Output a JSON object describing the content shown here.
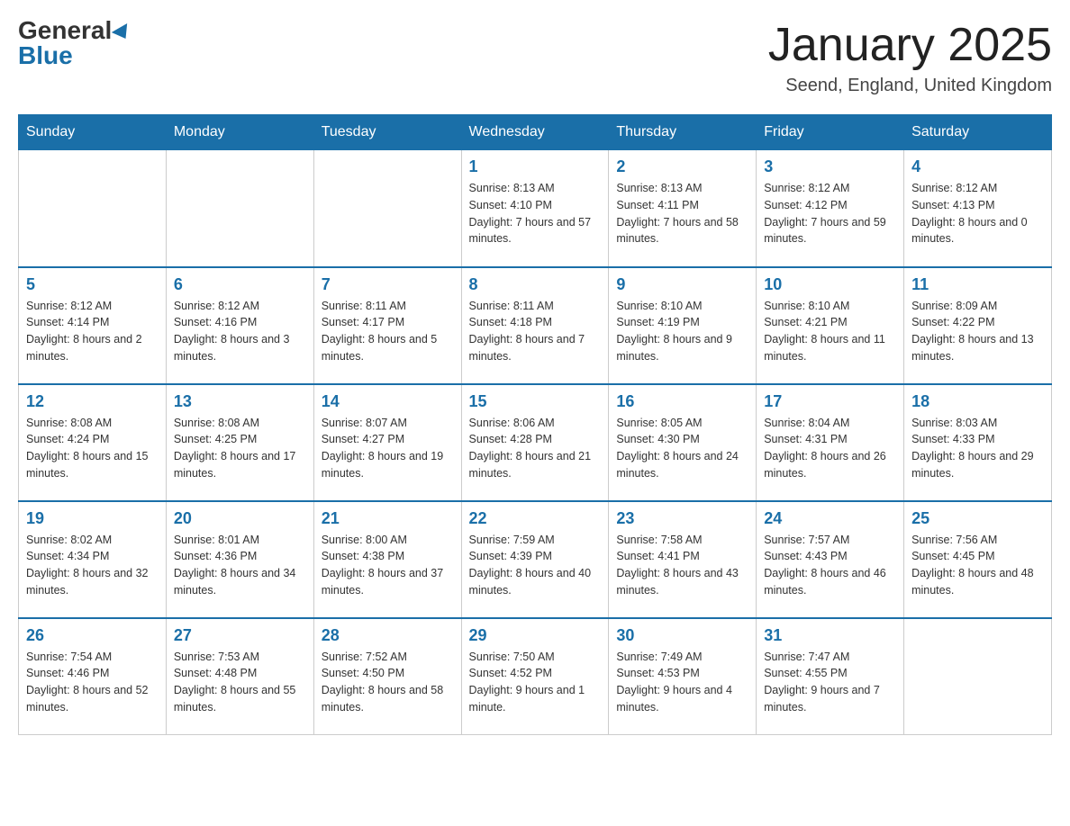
{
  "header": {
    "logo_general": "General",
    "logo_blue": "Blue",
    "title": "January 2025",
    "location": "Seend, England, United Kingdom"
  },
  "days_of_week": [
    "Sunday",
    "Monday",
    "Tuesday",
    "Wednesday",
    "Thursday",
    "Friday",
    "Saturday"
  ],
  "weeks": [
    [
      null,
      null,
      null,
      {
        "day": 1,
        "sunrise": "Sunrise: 8:13 AM",
        "sunset": "Sunset: 4:10 PM",
        "daylight": "Daylight: 7 hours and 57 minutes."
      },
      {
        "day": 2,
        "sunrise": "Sunrise: 8:13 AM",
        "sunset": "Sunset: 4:11 PM",
        "daylight": "Daylight: 7 hours and 58 minutes."
      },
      {
        "day": 3,
        "sunrise": "Sunrise: 8:12 AM",
        "sunset": "Sunset: 4:12 PM",
        "daylight": "Daylight: 7 hours and 59 minutes."
      },
      {
        "day": 4,
        "sunrise": "Sunrise: 8:12 AM",
        "sunset": "Sunset: 4:13 PM",
        "daylight": "Daylight: 8 hours and 0 minutes."
      }
    ],
    [
      {
        "day": 5,
        "sunrise": "Sunrise: 8:12 AM",
        "sunset": "Sunset: 4:14 PM",
        "daylight": "Daylight: 8 hours and 2 minutes."
      },
      {
        "day": 6,
        "sunrise": "Sunrise: 8:12 AM",
        "sunset": "Sunset: 4:16 PM",
        "daylight": "Daylight: 8 hours and 3 minutes."
      },
      {
        "day": 7,
        "sunrise": "Sunrise: 8:11 AM",
        "sunset": "Sunset: 4:17 PM",
        "daylight": "Daylight: 8 hours and 5 minutes."
      },
      {
        "day": 8,
        "sunrise": "Sunrise: 8:11 AM",
        "sunset": "Sunset: 4:18 PM",
        "daylight": "Daylight: 8 hours and 7 minutes."
      },
      {
        "day": 9,
        "sunrise": "Sunrise: 8:10 AM",
        "sunset": "Sunset: 4:19 PM",
        "daylight": "Daylight: 8 hours and 9 minutes."
      },
      {
        "day": 10,
        "sunrise": "Sunrise: 8:10 AM",
        "sunset": "Sunset: 4:21 PM",
        "daylight": "Daylight: 8 hours and 11 minutes."
      },
      {
        "day": 11,
        "sunrise": "Sunrise: 8:09 AM",
        "sunset": "Sunset: 4:22 PM",
        "daylight": "Daylight: 8 hours and 13 minutes."
      }
    ],
    [
      {
        "day": 12,
        "sunrise": "Sunrise: 8:08 AM",
        "sunset": "Sunset: 4:24 PM",
        "daylight": "Daylight: 8 hours and 15 minutes."
      },
      {
        "day": 13,
        "sunrise": "Sunrise: 8:08 AM",
        "sunset": "Sunset: 4:25 PM",
        "daylight": "Daylight: 8 hours and 17 minutes."
      },
      {
        "day": 14,
        "sunrise": "Sunrise: 8:07 AM",
        "sunset": "Sunset: 4:27 PM",
        "daylight": "Daylight: 8 hours and 19 minutes."
      },
      {
        "day": 15,
        "sunrise": "Sunrise: 8:06 AM",
        "sunset": "Sunset: 4:28 PM",
        "daylight": "Daylight: 8 hours and 21 minutes."
      },
      {
        "day": 16,
        "sunrise": "Sunrise: 8:05 AM",
        "sunset": "Sunset: 4:30 PM",
        "daylight": "Daylight: 8 hours and 24 minutes."
      },
      {
        "day": 17,
        "sunrise": "Sunrise: 8:04 AM",
        "sunset": "Sunset: 4:31 PM",
        "daylight": "Daylight: 8 hours and 26 minutes."
      },
      {
        "day": 18,
        "sunrise": "Sunrise: 8:03 AM",
        "sunset": "Sunset: 4:33 PM",
        "daylight": "Daylight: 8 hours and 29 minutes."
      }
    ],
    [
      {
        "day": 19,
        "sunrise": "Sunrise: 8:02 AM",
        "sunset": "Sunset: 4:34 PM",
        "daylight": "Daylight: 8 hours and 32 minutes."
      },
      {
        "day": 20,
        "sunrise": "Sunrise: 8:01 AM",
        "sunset": "Sunset: 4:36 PM",
        "daylight": "Daylight: 8 hours and 34 minutes."
      },
      {
        "day": 21,
        "sunrise": "Sunrise: 8:00 AM",
        "sunset": "Sunset: 4:38 PM",
        "daylight": "Daylight: 8 hours and 37 minutes."
      },
      {
        "day": 22,
        "sunrise": "Sunrise: 7:59 AM",
        "sunset": "Sunset: 4:39 PM",
        "daylight": "Daylight: 8 hours and 40 minutes."
      },
      {
        "day": 23,
        "sunrise": "Sunrise: 7:58 AM",
        "sunset": "Sunset: 4:41 PM",
        "daylight": "Daylight: 8 hours and 43 minutes."
      },
      {
        "day": 24,
        "sunrise": "Sunrise: 7:57 AM",
        "sunset": "Sunset: 4:43 PM",
        "daylight": "Daylight: 8 hours and 46 minutes."
      },
      {
        "day": 25,
        "sunrise": "Sunrise: 7:56 AM",
        "sunset": "Sunset: 4:45 PM",
        "daylight": "Daylight: 8 hours and 48 minutes."
      }
    ],
    [
      {
        "day": 26,
        "sunrise": "Sunrise: 7:54 AM",
        "sunset": "Sunset: 4:46 PM",
        "daylight": "Daylight: 8 hours and 52 minutes."
      },
      {
        "day": 27,
        "sunrise": "Sunrise: 7:53 AM",
        "sunset": "Sunset: 4:48 PM",
        "daylight": "Daylight: 8 hours and 55 minutes."
      },
      {
        "day": 28,
        "sunrise": "Sunrise: 7:52 AM",
        "sunset": "Sunset: 4:50 PM",
        "daylight": "Daylight: 8 hours and 58 minutes."
      },
      {
        "day": 29,
        "sunrise": "Sunrise: 7:50 AM",
        "sunset": "Sunset: 4:52 PM",
        "daylight": "Daylight: 9 hours and 1 minute."
      },
      {
        "day": 30,
        "sunrise": "Sunrise: 7:49 AM",
        "sunset": "Sunset: 4:53 PM",
        "daylight": "Daylight: 9 hours and 4 minutes."
      },
      {
        "day": 31,
        "sunrise": "Sunrise: 7:47 AM",
        "sunset": "Sunset: 4:55 PM",
        "daylight": "Daylight: 9 hours and 7 minutes."
      },
      null
    ]
  ]
}
